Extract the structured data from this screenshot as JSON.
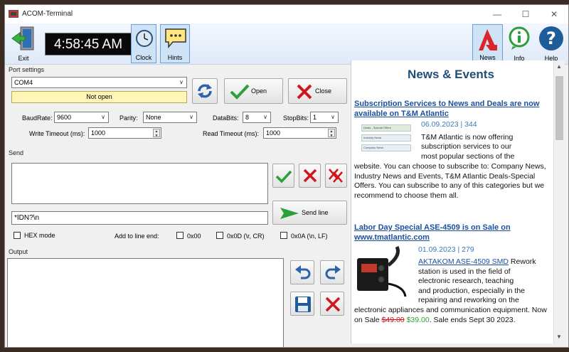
{
  "window": {
    "title": "ACOM-Terminal",
    "minimize": "—",
    "maximize": "☐",
    "close": "✕"
  },
  "toolbar": {
    "exit": "Exit",
    "time": "4:58:45 AM",
    "clock": "Clock",
    "hints": "Hints",
    "news": "News",
    "info": "Info",
    "help": "Help"
  },
  "port": {
    "group": "Port settings",
    "port_value": "COM4",
    "status": "Not open",
    "open": "Open",
    "close": "Close",
    "baud_label": "BaudRate:",
    "baud": "9600",
    "parity_label": "Parity:",
    "parity": "None",
    "databits_label": "DataBits:",
    "databits": "8",
    "stopbits_label": "StopBits:",
    "stopbits": "1",
    "wt_label": "Write Timeout (ms):",
    "wt": "1000",
    "rt_label": "Read Timeout (ms):",
    "rt": "1000"
  },
  "send": {
    "group": "Send",
    "line": "*IDN?\\n",
    "send_line": "Send line",
    "hex": "HEX mode",
    "add_label": "Add to line end:",
    "opt1": "0x00",
    "opt2": "0x0D (\\r, CR)",
    "opt3": "0x0A (\\n, LF)"
  },
  "output": {
    "group": "Output"
  },
  "news": {
    "heading": "News & Events",
    "a1_title": "Subscription Services to News and Deals are now available on T&M Atlantic",
    "a1_meta": "06.09.2023 | 344",
    "a1_thumb": [
      "Deals - Special Offers",
      "Industry News",
      "Company News"
    ],
    "a1_text1": "T&M Atlantic is now offering",
    "a1_text2": "subscription services to our",
    "a1_text3": "most popular sections of the",
    "a1_text4": "website. You can choose to subscribe to: Company News, Industry News and Events, T&M Atlantic Deals-Special Offers. You can subscribe to any of this categories but we recommend to choose them all.",
    "a2_title": "Labor Day Special ASE-4509 is on Sale on www.tmatlantic.com",
    "a2_meta": "01.09.2023 | 279",
    "a2_link": "AKTAKOM ASE-4509 SMD",
    "a2_text1": " Rework",
    "a2_text2": "station is used in the field of",
    "a2_text3": "electronic research, teaching",
    "a2_text4": "and production, especially in the",
    "a2_text5": "repairing and reworking on the",
    "a2_text6": "electronic appliances and communication equipment. Now on Sale ",
    "a2_old": "$49.00",
    "a2_new": "$39.00",
    "a2_end": ". Sale ends Sept 30 2023."
  }
}
